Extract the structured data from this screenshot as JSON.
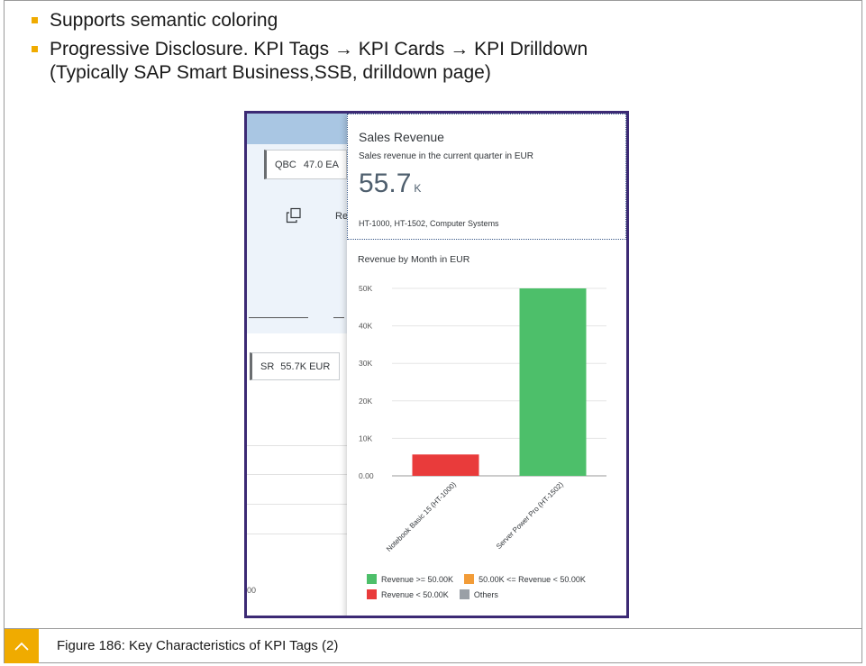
{
  "bullets": [
    {
      "text": "Supports semantic coloring"
    },
    {
      "text": "Progressive Disclosure. KPI Tags → KPI Cards → KPI Drilldown",
      "line2": "(Typically SAP Smart Business,SSB, drilldown page)"
    }
  ],
  "app": {
    "qbc_tag": {
      "abbr": "QBC",
      "value": "47.0 EA"
    },
    "re_text": "Re",
    "sr_tag": {
      "abbr": "SR",
      "value": "55.7K EUR"
    },
    "partial_number": "00"
  },
  "kpi_card": {
    "title": "Sales Revenue",
    "subtitle": "Sales revenue in the current quarter in EUR",
    "value": "55.7",
    "unit": "K",
    "filters": "HT-1000, HT-1502, Computer Systems",
    "chart_title": "Revenue by Month in EUR"
  },
  "chart_data": {
    "type": "bar",
    "title": "Revenue by Month in EUR",
    "categories": [
      "Notebook Basic 15 (HT-1000)",
      "Server Power Pro (HT-1502)"
    ],
    "values": [
      5700,
      50000
    ],
    "colors": [
      "#e93b3b",
      "#4dbf6a"
    ],
    "ylim": [
      0,
      50000
    ],
    "ytick_labels": [
      "0.00",
      "10K",
      "20K",
      "30K",
      "40K",
      "50K"
    ],
    "ytick_values": [
      0,
      10000,
      20000,
      30000,
      40000,
      50000
    ],
    "grid": true,
    "legend": [
      {
        "label": "Revenue >= 50.00K",
        "color": "#4dbf6a"
      },
      {
        "label": "50.00K <= Revenue < 50.00K",
        "color": "#f29c38"
      },
      {
        "label": "Revenue < 50.00K",
        "color": "#e93b3b"
      },
      {
        "label": "Others",
        "color": "#9aa0a6"
      }
    ]
  },
  "footer": {
    "caption": "Figure 186: Key Characteristics of KPI Tags (2)"
  },
  "colors": {
    "accent": "#f0ab00",
    "frame": "#3c2a74",
    "header": "#a9c6e3"
  }
}
